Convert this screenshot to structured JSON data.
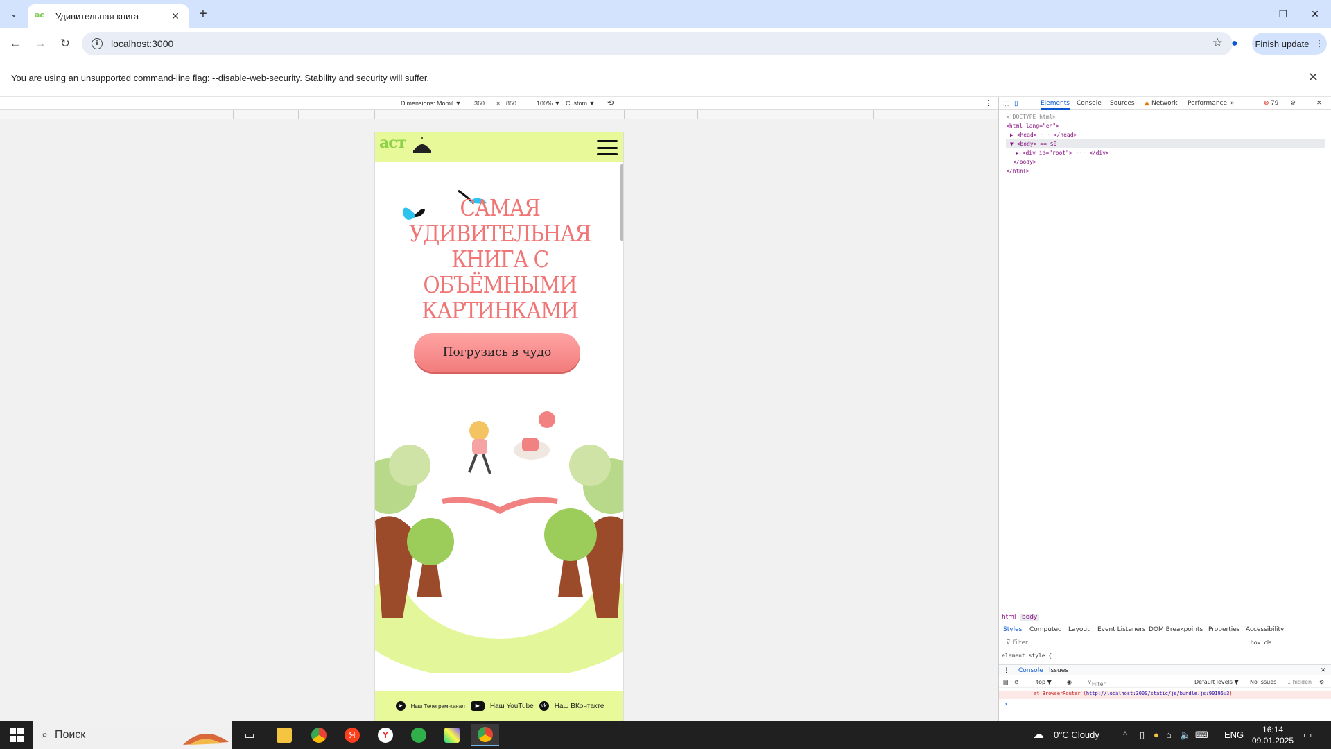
{
  "browser": {
    "tab_title": "Удивительная книга",
    "url": "localhost:3000",
    "finish_update": "Finish update",
    "infobar_message": "You are using an unsupported command-line flag: --disable-web-security. Stability and security will suffer."
  },
  "device_toolbar": {
    "dimensions": "Dimensions: Momil ▼",
    "width": "360",
    "times": "×",
    "height": "850",
    "zoom": "100% ▼",
    "throttle": "Custom ▼"
  },
  "site": {
    "logo": "аст",
    "hero_title": "САМАЯ УДИВИТЕЛЬНАЯ КНИГА С ОБЪЁМНЫМИ КАРТИНКАМИ",
    "cta_label": "Погрузись в чудо",
    "social_telegram": "Наш Телеграм-канал",
    "social_youtube": "Наш YouTube",
    "social_vk": "Наш ВКонтакте"
  },
  "devtools": {
    "tabs": [
      "Elements",
      "Console",
      "Sources",
      "Network",
      "Performance",
      "»"
    ],
    "error_count": "79",
    "dom_lines": [
      "<!DOCTYPE html>",
      "<html lang=\"en\">",
      "▶ <head> ··· </head>",
      "▼ <body> == $0",
      "▶ <div id=\"root\"> ··· </div>",
      "</body>",
      "</html>"
    ],
    "breadcrumb": [
      "html",
      "body"
    ],
    "style_tabs": [
      "Styles",
      "Computed",
      "Layout",
      "Event Listeners",
      "DOM Breakpoints",
      "Properties",
      "Accessibility"
    ],
    "filter_placeholder": "Filter",
    "hov_cls": ":hov .cls",
    "element_style": "element.style {",
    "console_tabs": [
      "Console",
      "Issues"
    ],
    "context": "top ▼",
    "console_filter": "Filter",
    "default_levels": "Default levels ▼",
    "no_issues": "No Issues",
    "hidden": "1 hidden",
    "error_line": "at BrowserRouter (",
    "error_link": "http://localhost:3000/static/js/bundle.js:90195:3",
    "error_tail": ")"
  },
  "taskbar": {
    "search_label": "Поиск",
    "weather": "0°C  Cloudy",
    "lang": "ENG",
    "time": "16:14",
    "date": "09.01.2025"
  },
  "colors": {
    "tabstrip": "#d3e3fd",
    "site_header": "#e8f99a",
    "hero_text": "#f07575",
    "cta": "#f27c7c"
  }
}
